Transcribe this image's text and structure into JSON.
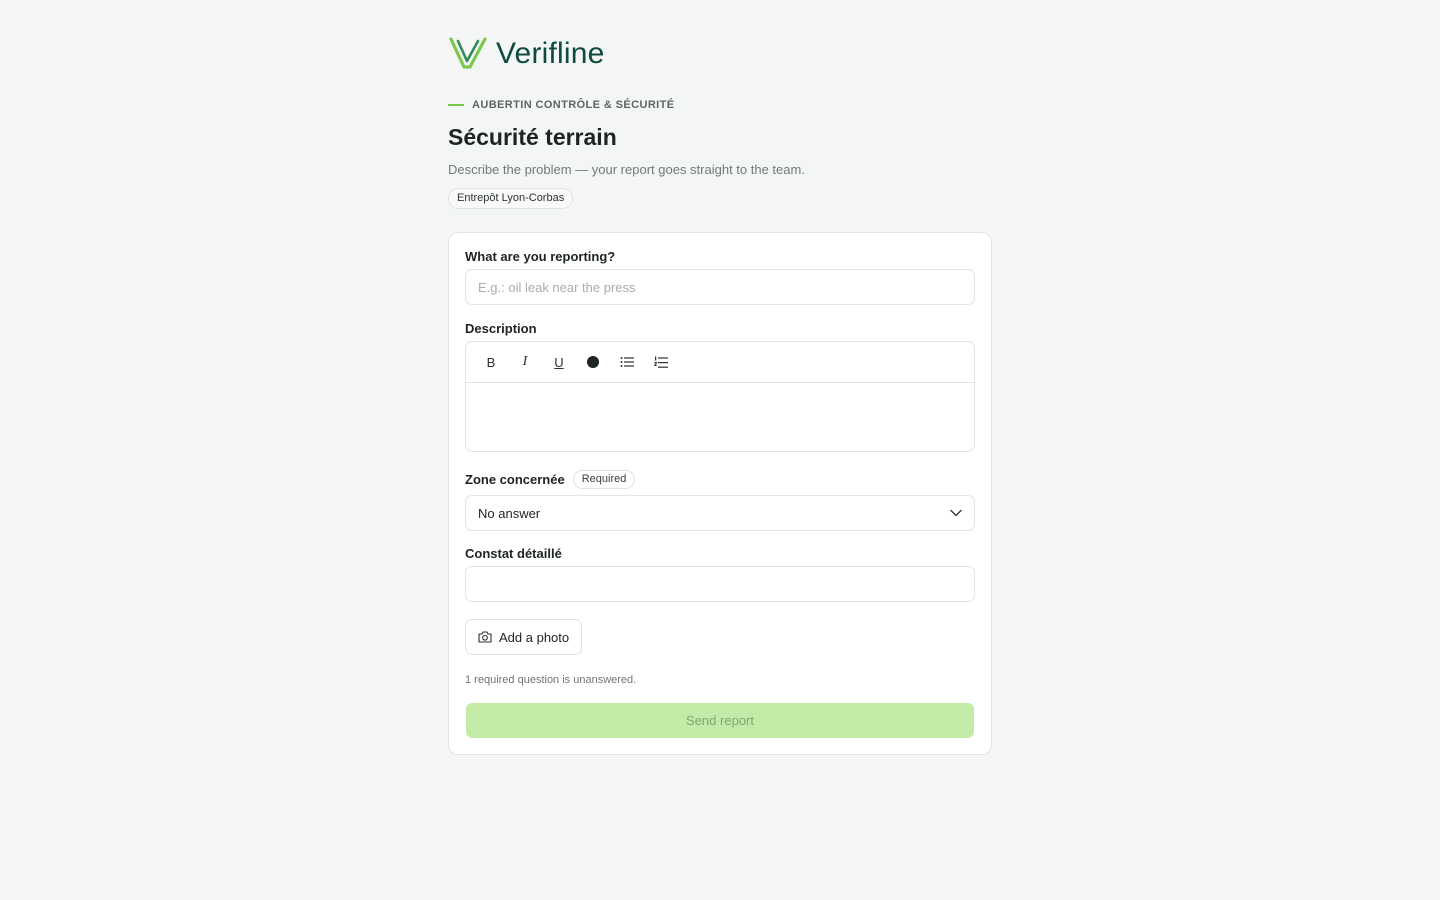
{
  "brand": {
    "name": "Verifline",
    "accent": "#7cc84a",
    "dark": "#0f4a40"
  },
  "header": {
    "kicker": "AUBERTIN CONTRÔLE & SÉCURITÉ",
    "title": "Sécurité terrain",
    "subtitle": "Describe the problem — your report goes straight to the team.",
    "site": "Entrepôt Lyon-Corbas"
  },
  "form": {
    "reporting": {
      "label": "What are you reporting?",
      "placeholder": "E.g.: oil leak near the press",
      "value": ""
    },
    "description": {
      "label": "Description",
      "toolbar": {
        "bold": "B",
        "italic": "I",
        "underline": "U",
        "icons": [
          "bold-icon",
          "italic-icon",
          "underline-icon",
          "color-dot-icon",
          "bullet-list-icon",
          "numbered-list-icon"
        ]
      },
      "value": ""
    },
    "zone": {
      "label": "Zone concernée",
      "badge": "Required",
      "value": "No answer"
    },
    "constat": {
      "label": "Constat détaillé",
      "value": ""
    },
    "photo_button": "Add a photo",
    "hint": "1 required question is unanswered.",
    "submit": "Send report",
    "submit_color": "#c4eaa8"
  }
}
